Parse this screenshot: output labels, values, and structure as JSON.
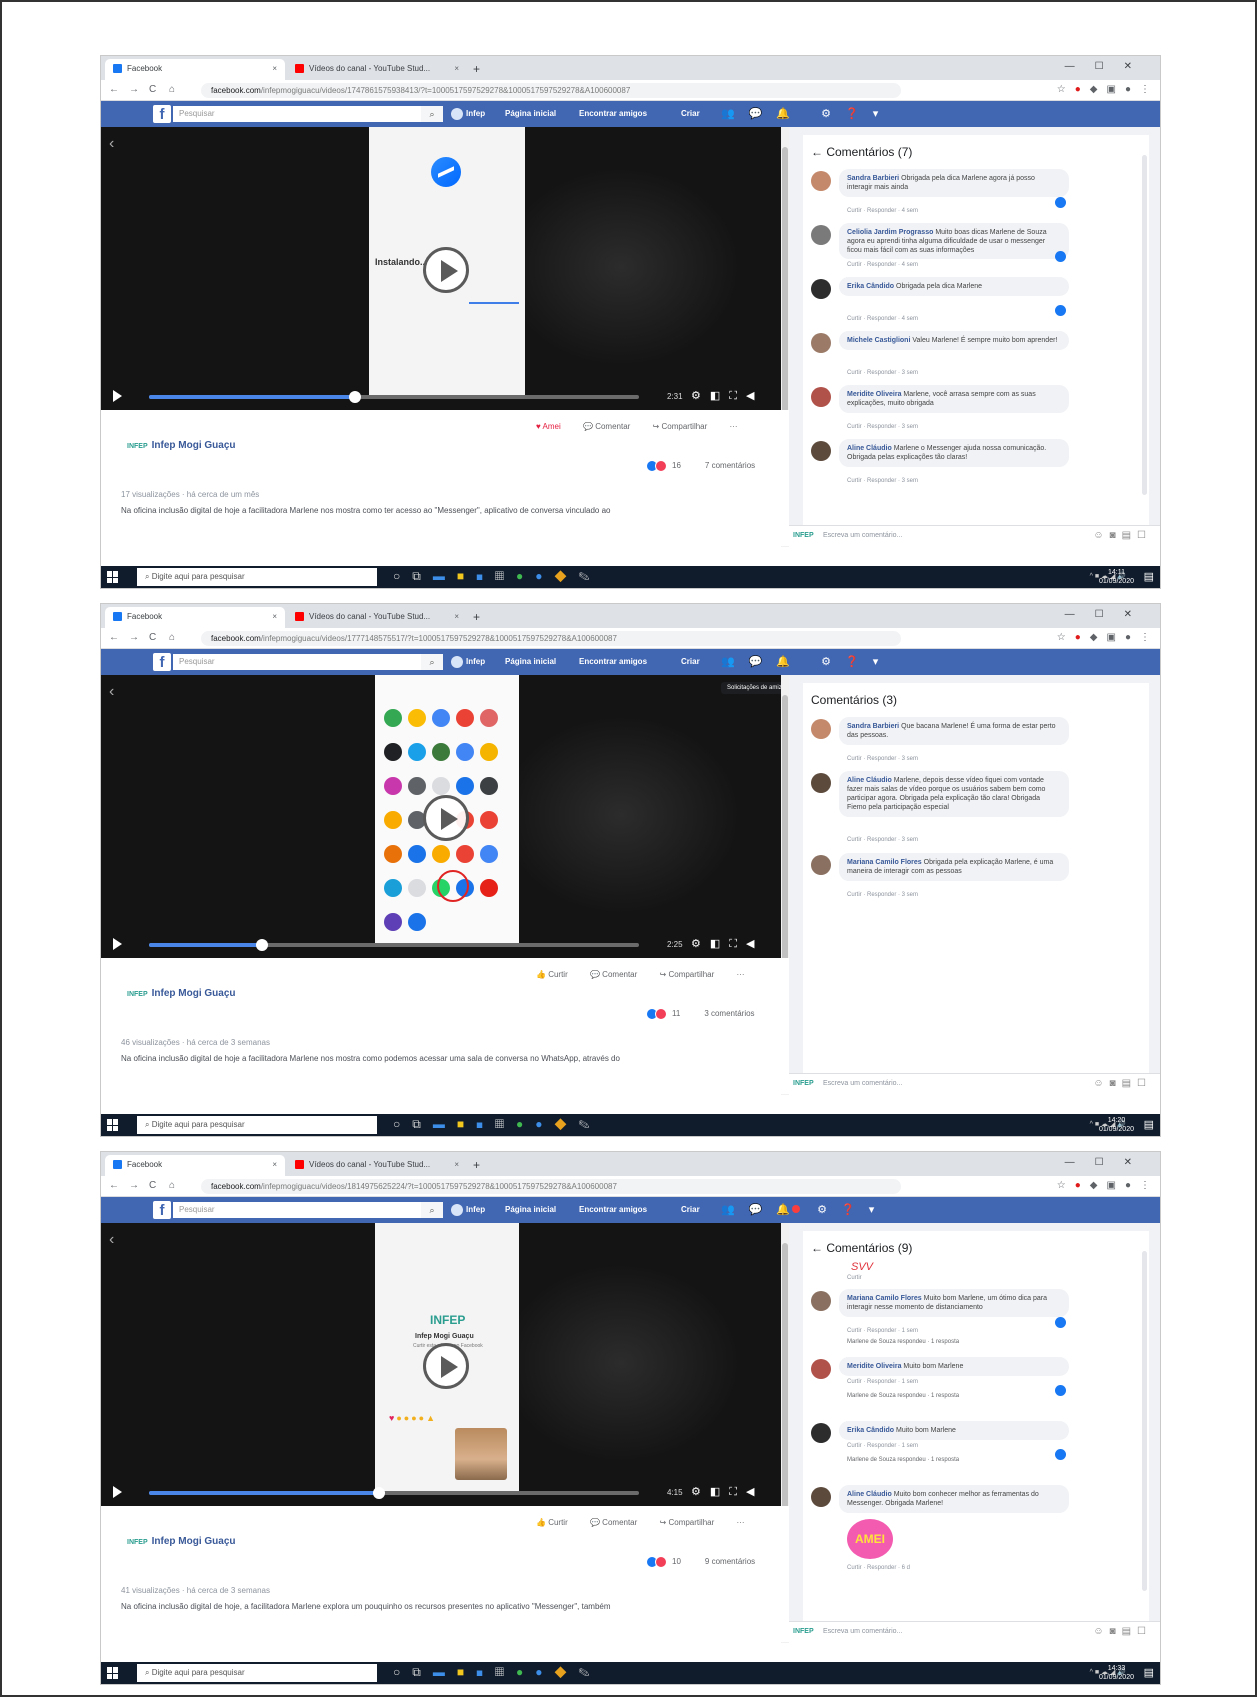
{
  "browser": {
    "tab_facebook": "Facebook",
    "tab_youtube": "Vídeos do canal - YouTube Stud...",
    "tab_close": "×",
    "new_tab": "+",
    "nav_back": "←",
    "nav_forward": "→",
    "nav_reload": "C",
    "nav_home": "⌂"
  },
  "facebook": {
    "logo": "f",
    "search_placeholder": "Pesquisar",
    "profile": "Infep",
    "nav_home": "Página inicial",
    "nav_friends": "Encontrar amigos",
    "nav_create": "Criar"
  },
  "video": {
    "page_name": "Infep Mogi Guaçu",
    "page_logo": "INFEP",
    "action_share": "Compartilhar",
    "action_comment": "Comentar",
    "action_love": "Amei",
    "action_like": "Curtir",
    "more": "···"
  },
  "comments_common": {
    "like": "Curtir",
    "reply": "Responder",
    "input_placeholder": "Escreva um comentário...",
    "brand": "INFEP"
  },
  "taskbar": {
    "search_placeholder": "Digite aqui para pesquisar",
    "date": "01/09/2020"
  },
  "screens": [
    {
      "url_host": "facebook.com",
      "url_rest": "/infepmogiguacu/videos/1747861575938413/?t=1000517597529278&1000517597529278&A100600087",
      "comments_title": "← Comentários (7)",
      "video_time": "2:31",
      "progress": 0.42,
      "phone_label": "Instalando...",
      "views": "17 visualizações · há cerca de um mês",
      "description": "Na oficina inclusão digital de hoje a facilitadora Marlene nos mostra como ter acesso ao \"Messenger\", aplicativo de conversa vinculado ao",
      "reaction_count": "16",
      "comment_count": "7 comentários",
      "time": "14:11",
      "comments": [
        {
          "name": "Sandra Barbieri",
          "text": "Obrigada pela dica Marlene agora já posso interagir mais ainda",
          "meta": "Curtir · Responder · 4 sem"
        },
        {
          "name": "Celiolia Jardim Prograsso",
          "text": "Muito boas dicas Marlene de Souza agora eu aprendi tinha alguma dificuldade de usar o messenger ficou mais fácil com as suas informações",
          "meta": "Curtir · Responder · 4 sem"
        },
        {
          "name": "Erika Cândido",
          "text": "Obrigada pela dica Marlene",
          "meta": "Curtir · Responder · 4 sem"
        },
        {
          "name": "Michele Castiglioni",
          "text": "Valeu Marlene! É sempre muito bom aprender!",
          "meta": "Curtir · Responder · 3 sem"
        },
        {
          "name": "Meridite Oliveira",
          "text": "Marlene, você arrasa sempre com as suas explicações, muito obrigada",
          "meta": "Curtir · Responder · 3 sem"
        },
        {
          "name": "Aline Cláudio",
          "text": "Marlene o Messenger ajuda nossa comunicação. Obrigada pelas explicações tão claras!",
          "meta": "Curtir · Responder · 3 sem"
        }
      ]
    },
    {
      "url_host": "facebook.com",
      "url_rest": "/infepmogiguacu/videos/1777148575517/?t=1000517597529278&1000517597529278&A100600087",
      "comments_title": "Comentários (3)",
      "tooltip": "Solicitações de amizade",
      "video_time": "2:25",
      "progress": 0.23,
      "views": "46 visualizações · há cerca de 3 semanas",
      "description": "Na oficina inclusão digital de hoje a facilitadora Marlene nos mostra como podemos acessar uma sala de conversa no WhatsApp, através do",
      "reaction_count": "11",
      "comment_count": "3 comentários",
      "time": "14:20",
      "comments": [
        {
          "name": "Sandra Barbieri",
          "text": "Que bacana Marlene! É uma forma de estar perto das pessoas.",
          "meta": "Curtir · Responder · 3 sem"
        },
        {
          "name": "Aline Cláudio",
          "text": "Marlene, depois desse vídeo fiquei com vontade fazer mais salas de vídeo porque os usuários sabem bem como participar agora. Obrigada pela explicação tão clara! Obrigada Fiemo pela participação especial",
          "meta": "Curtir · Responder · 3 sem"
        },
        {
          "name": "Mariana Camilo Flores",
          "text": "Obrigada pela explicação Marlene, é uma maneira de interagir com as pessoas",
          "meta": "Curtir · Responder · 3 sem"
        }
      ]
    },
    {
      "url_host": "facebook.com",
      "url_rest": "/infepmogiguacu/videos/1814975625224/?t=1000517597529278&1000517597529278&A100600087",
      "comments_title": "← Comentários (9)",
      "video_time": "4:15",
      "progress": 0.47,
      "phone_logo": "INFEP",
      "phone_page": "Infep Mogi Guaçu",
      "phone_sub": "Curtir esta página no Facebook",
      "views": "41 visualizações · há cerca de 3 semanas",
      "description": "Na oficina inclusão digital de hoje, a facilitadora Marlene explora um pouquinho os recursos presentes no aplicativo \"Messenger\", também",
      "reaction_count": "10",
      "comment_count": "9 comentários",
      "time": "14:33",
      "signature": "SVV",
      "sticker": "AMEI",
      "comments": [
        {
          "name": "Mariana Camilo Flores",
          "text": "Muito bom Marlene, um ótimo dica para interagir nesse momento de distanciamento",
          "meta": "Curtir · Responder · 1 sem",
          "reply": "Marlene de Souza respondeu · 1 resposta"
        },
        {
          "name": "Meridite Oliveira",
          "text": "Muito bom Marlene",
          "meta": "Curtir · Responder · 1 sem",
          "reply": "Marlene de Souza respondeu · 1 resposta"
        },
        {
          "name": "Erika Cândido",
          "text": "Muito bom Marlene",
          "meta": "Curtir · Responder · 1 sem",
          "reply": "Marlene de Souza respondeu · 1 resposta"
        },
        {
          "name": "Aline Cláudio",
          "text": "Muito bom conhecer melhor as ferramentas do Messenger. Obrigada Marlene!",
          "meta": "Curtir · Responder · 6 d"
        }
      ]
    }
  ]
}
